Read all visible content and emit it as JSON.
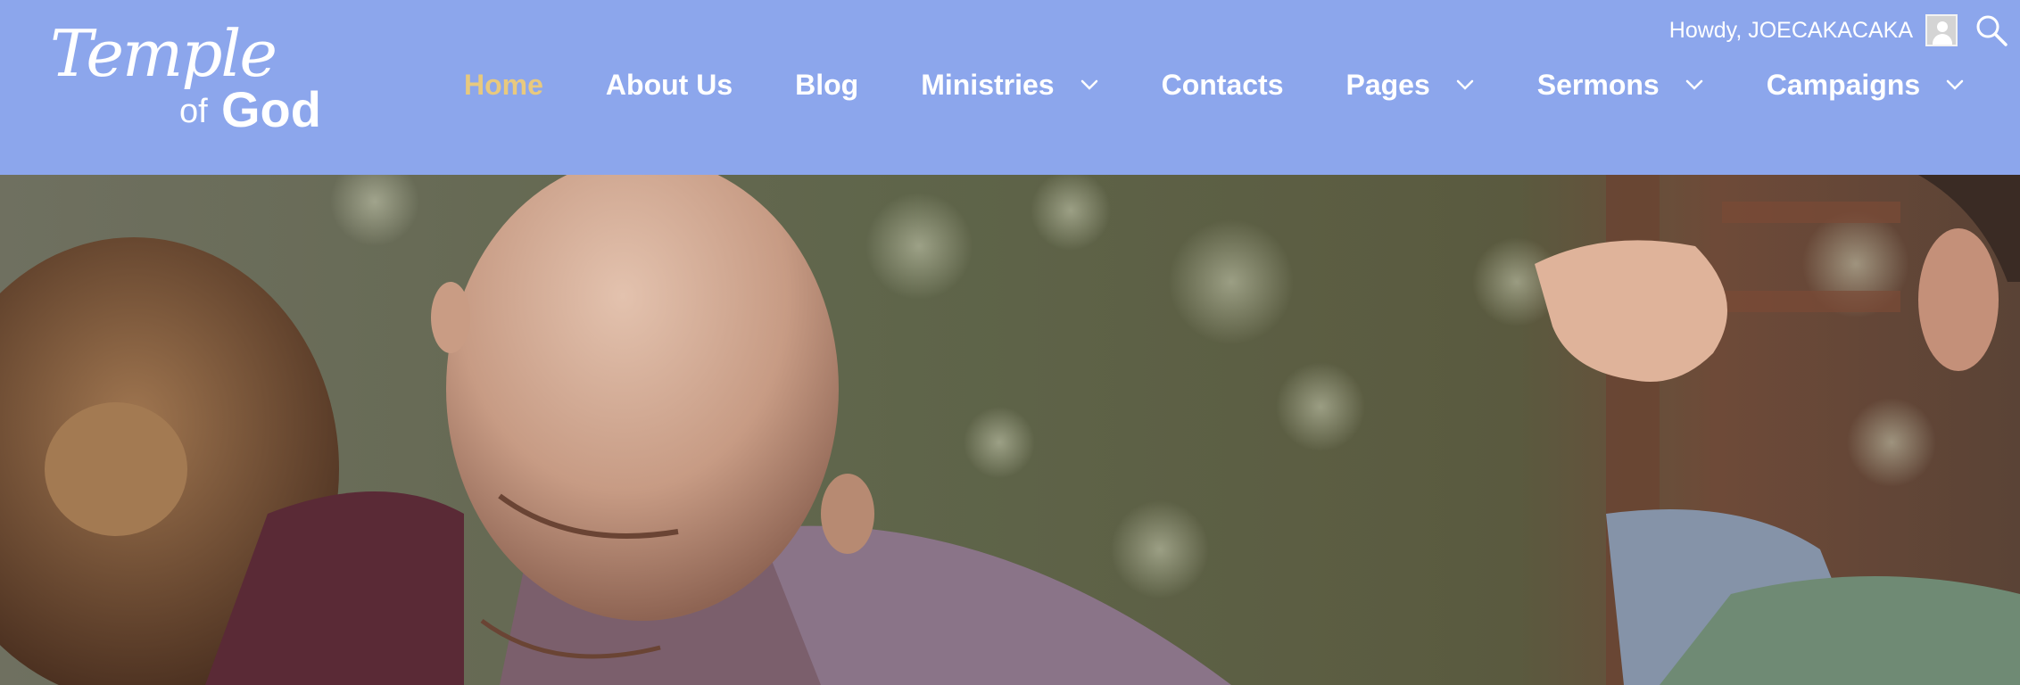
{
  "colors": {
    "header_bg": "#8ca6ec",
    "nav_text": "#ffffff",
    "nav_active": "#e8c97e"
  },
  "logo": {
    "line1": "Temple",
    "line2_small": "of",
    "line2_big": "God"
  },
  "admin": {
    "greeting": "Howdy, JOECAKACAKA",
    "avatar_icon": "user-avatar-icon",
    "search_icon": "search-icon"
  },
  "nav": [
    {
      "label": "Home",
      "active": true,
      "dropdown": false
    },
    {
      "label": "About Us",
      "active": false,
      "dropdown": false
    },
    {
      "label": "Blog",
      "active": false,
      "dropdown": false
    },
    {
      "label": "Ministries",
      "active": false,
      "dropdown": true
    },
    {
      "label": "Contacts",
      "active": false,
      "dropdown": false
    },
    {
      "label": "Pages",
      "active": false,
      "dropdown": true
    },
    {
      "label": "Sermons",
      "active": false,
      "dropdown": true
    },
    {
      "label": "Campaigns",
      "active": false,
      "dropdown": true
    }
  ],
  "hero": {
    "image": "photo of smiling bald man embracing people outdoors"
  }
}
